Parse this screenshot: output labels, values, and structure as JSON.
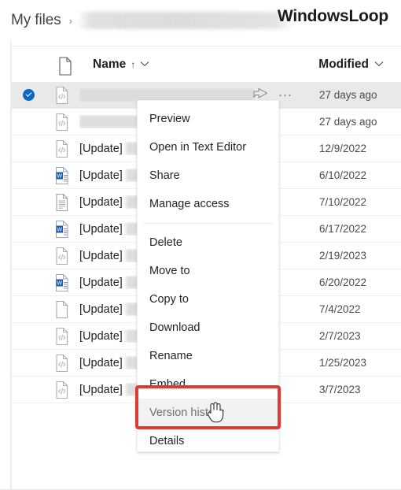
{
  "breadcrumb": {
    "root_label": "My files",
    "separator": "›",
    "redacted_segment": ""
  },
  "brand": {
    "title": "WindowsLoop"
  },
  "columns": {
    "file_type_icon": "document-icon",
    "name_label": "Name",
    "sort_indicator": "↑",
    "chevron": "⌄",
    "modified_label": "Modified"
  },
  "rows": [
    {
      "selected": true,
      "icon": "code-file-icon",
      "name": "",
      "redacted": true,
      "redacted_width": 230,
      "modified": "27 days ago",
      "show_actions": true
    },
    {
      "selected": false,
      "icon": "code-file-icon",
      "name": "",
      "redacted": true,
      "redacted_width": 230,
      "modified": "27 days ago",
      "show_actions": false
    },
    {
      "selected": false,
      "icon": "code-file-icon",
      "name": "[Update]",
      "redacted": true,
      "redacted_width": 190,
      "modified": "12/9/2022",
      "show_actions": false
    },
    {
      "selected": false,
      "icon": "word-file-icon",
      "name": "[Update]",
      "redacted": true,
      "redacted_width": 190,
      "modified": "6/10/2022",
      "show_actions": false
    },
    {
      "selected": false,
      "icon": "text-file-icon",
      "name": "[Update]",
      "redacted": true,
      "redacted_width": 190,
      "modified": "7/10/2022",
      "show_actions": false
    },
    {
      "selected": false,
      "icon": "word-file-icon",
      "name": "[Update]",
      "redacted": true,
      "redacted_width": 190,
      "modified": "6/17/2022",
      "show_actions": false
    },
    {
      "selected": false,
      "icon": "code-file-icon",
      "name": "[Update]",
      "redacted": true,
      "redacted_width": 190,
      "modified": "2/19/2023",
      "show_actions": false
    },
    {
      "selected": false,
      "icon": "word-file-icon",
      "name": "[Update]",
      "redacted": true,
      "redacted_width": 190,
      "modified": "6/20/2022",
      "show_actions": false
    },
    {
      "selected": false,
      "icon": "blank-file-icon",
      "name": "[Update]",
      "redacted": true,
      "redacted_width": 190,
      "modified": "7/4/2022",
      "show_actions": false
    },
    {
      "selected": false,
      "icon": "code-file-icon",
      "name": "[Update]",
      "redacted": true,
      "redacted_width": 190,
      "modified": "2/7/2023",
      "show_actions": false
    },
    {
      "selected": false,
      "icon": "code-file-icon",
      "name": "[Update]",
      "redacted": true,
      "redacted_width": 190,
      "modified": "1/25/2023",
      "show_actions": false
    },
    {
      "selected": false,
      "icon": "code-file-icon",
      "name": "[Update]",
      "redacted": true,
      "redacted_width": 190,
      "modified": "3/7/2023",
      "show_actions": false
    }
  ],
  "context_menu": {
    "items": [
      {
        "label": "Preview",
        "separator_after": false,
        "highlighted": false
      },
      {
        "label": "Open in Text Editor",
        "separator_after": false,
        "highlighted": false
      },
      {
        "label": "Share",
        "separator_after": false,
        "highlighted": false
      },
      {
        "label": "Manage access",
        "separator_after": true,
        "highlighted": false
      },
      {
        "label": "Delete",
        "separator_after": false,
        "highlighted": false
      },
      {
        "label": "Move to",
        "separator_after": false,
        "highlighted": false
      },
      {
        "label": "Copy to",
        "separator_after": false,
        "highlighted": false
      },
      {
        "label": "Download",
        "separator_after": false,
        "highlighted": false
      },
      {
        "label": "Rename",
        "separator_after": false,
        "highlighted": false
      },
      {
        "label": "Embed",
        "separator_after": false,
        "highlighted": false
      },
      {
        "label": "Version history",
        "separator_after": false,
        "highlighted": true
      },
      {
        "label": "Details",
        "separator_after": false,
        "highlighted": false
      }
    ]
  },
  "annotation": {
    "highlight_color": "#e03a33",
    "target_label": "Version history"
  },
  "row_actions": {
    "share_icon": "share-icon",
    "more_icon": "ellipsis-icon",
    "more_glyph": "···"
  }
}
